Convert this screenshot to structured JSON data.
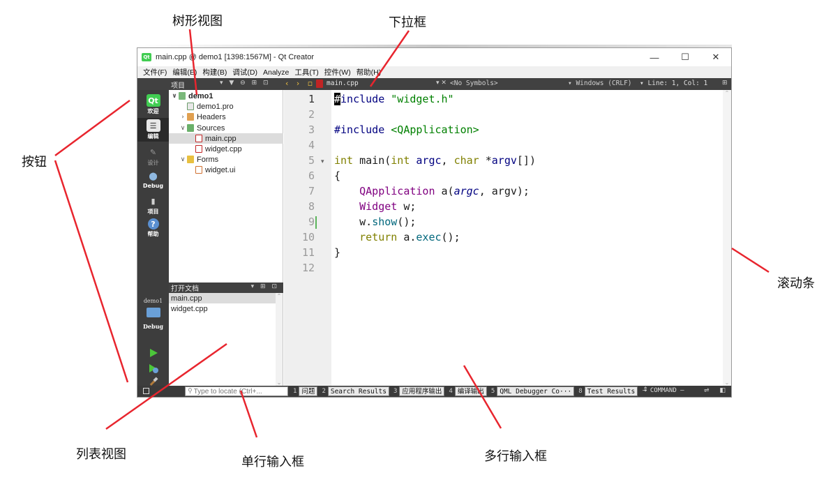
{
  "annotations": {
    "tree_view": "树形视图",
    "dropdown": "下拉框",
    "button": "按钮",
    "scrollbar": "滚动条",
    "list_view": "列表视图",
    "line_edit": "单行输入框",
    "text_edit": "多行输入框"
  },
  "window": {
    "title": "main.cpp @ demo1 [1398:1567M] - Qt Creator",
    "logo": "Qt",
    "controls": {
      "minimize": "—",
      "maximize": "☐",
      "close": "✕"
    }
  },
  "menu": [
    "文件(F)",
    "编辑(E)",
    "构建(B)",
    "调试(D)",
    "Analyze",
    "工具(T)",
    "控件(W)",
    "帮助(H)"
  ],
  "toolbar": {
    "project_label": "项目",
    "project_icons": "▾ ▼ ⊖ ⊞ ⊡",
    "nav": "‹ › ▫",
    "file_combo": "main.cpp",
    "file_combo_arrow": "▾ ✕",
    "symbols": "<No Symbols>",
    "encoding": "▾ Windows (CRLF)",
    "position": "▾ Line: 1, Col: 1",
    "split": "⊞"
  },
  "modes": [
    {
      "label": "欢迎",
      "icon": "Qt"
    },
    {
      "label": "编辑",
      "icon": "☰"
    },
    {
      "label": "设计",
      "icon": "✎"
    },
    {
      "label": "Debug",
      "icon": "⬤"
    },
    {
      "label": "项目",
      "icon": "▮"
    },
    {
      "label": "帮助",
      "icon": "?"
    }
  ],
  "kit": {
    "project": "demo1",
    "build": "Debug"
  },
  "tree": [
    {
      "label": "demo1",
      "arrow": "∨"
    },
    {
      "label": "demo1.pro",
      "arrow": ""
    },
    {
      "label": "Headers",
      "arrow": "›"
    },
    {
      "label": "Sources",
      "arrow": "∨"
    },
    {
      "label": "main.cpp",
      "arrow": ""
    },
    {
      "label": "widget.cpp",
      "arrow": ""
    },
    {
      "label": "Forms",
      "arrow": "∨"
    },
    {
      "label": "widget.ui",
      "arrow": ""
    }
  ],
  "open_documents": {
    "title": "打开文档",
    "icons": "▾ ⊞ ⊡",
    "items": [
      "main.cpp",
      "widget.cpp"
    ]
  },
  "editor": {
    "line_numbers": [
      "1",
      "2",
      "3",
      "4",
      "5",
      "6",
      "7",
      "8",
      "9",
      "10",
      "11",
      "12"
    ],
    "fold_marker": "▾",
    "code": [
      "#include \"widget.h\"",
      "",
      "#include <QApplication>",
      "",
      "int main(int argc, char *argv[])",
      "{",
      "    QApplication a(argc, argv);",
      "    Widget w;",
      "    w.show();",
      "    return a.exec();",
      "}",
      ""
    ]
  },
  "statusbar": {
    "locator_placeholder": "Type to locate (Ctrl+...",
    "panes": [
      {
        "num": "1",
        "label": "问题"
      },
      {
        "num": "2",
        "label": "Search Results"
      },
      {
        "num": "3",
        "label": "应用程序输出"
      },
      {
        "num": "4",
        "label": "编译输出"
      },
      {
        "num": "5",
        "label": "QML Debugger Co···"
      },
      {
        "num": "8",
        "label": "Test Results"
      }
    ],
    "more": "⇕",
    "command": "— COMMAND —",
    "right_icons": "⇌ ◧"
  },
  "colors": {
    "dark_panel": "#414141",
    "mode_bar": "#3d3d3d",
    "annotation_line": "#e8252e",
    "keyword": "#808000",
    "string": "#008000",
    "type": "#800080"
  }
}
